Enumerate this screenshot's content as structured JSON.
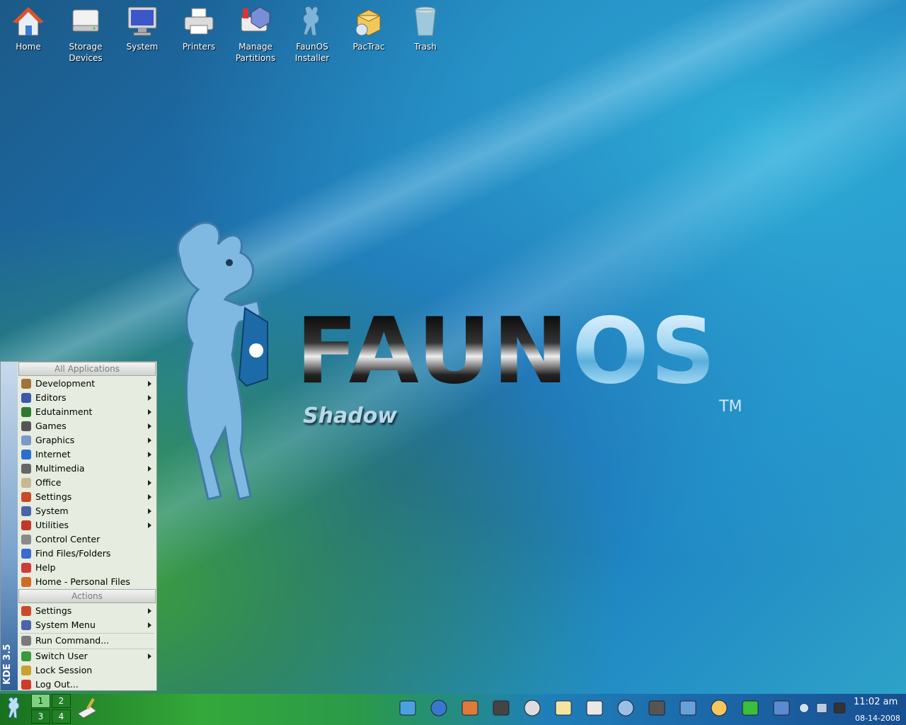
{
  "desktop_icons": [
    {
      "label": "Home",
      "icon": "home-icon"
    },
    {
      "label": "Storage\nDevices",
      "icon": "drive-icon"
    },
    {
      "label": "System",
      "icon": "monitor-icon"
    },
    {
      "label": "Printers",
      "icon": "printer-icon"
    },
    {
      "label": "Manage\nPartitions",
      "icon": "partition-icon"
    },
    {
      "label": "FaunOS\nInstaller",
      "icon": "goat-icon"
    },
    {
      "label": "PacTrac",
      "icon": "package-icon"
    },
    {
      "label": "Trash",
      "icon": "trash-icon"
    }
  ],
  "logo": {
    "faun": "FAUN",
    "os": "OS",
    "tm": "TM",
    "edition": "Shadow"
  },
  "kmenu": {
    "sidebar_text": "KDE 3.5",
    "header_all": "All Applications",
    "header_actions": "Actions",
    "apps": [
      {
        "label": "Development",
        "submenu": true,
        "color": "#a0743a"
      },
      {
        "label": "Editors",
        "submenu": true,
        "color": "#3a5aa8"
      },
      {
        "label": "Edutainment",
        "submenu": true,
        "color": "#2f7a2f"
      },
      {
        "label": "Games",
        "submenu": true,
        "color": "#555555"
      },
      {
        "label": "Graphics",
        "submenu": true,
        "color": "#7a98c8"
      },
      {
        "label": "Internet",
        "submenu": true,
        "color": "#2a6fd0"
      },
      {
        "label": "Multimedia",
        "submenu": true,
        "color": "#666666"
      },
      {
        "label": "Office",
        "submenu": true,
        "color": "#c8b890"
      },
      {
        "label": "Settings",
        "submenu": true,
        "color": "#c84a2a"
      },
      {
        "label": "System",
        "submenu": true,
        "color": "#4a64a8"
      },
      {
        "label": "Utilities",
        "submenu": true,
        "color": "#c0392b"
      },
      {
        "label": "Control Center",
        "submenu": false,
        "color": "#8a8a8a"
      },
      {
        "label": "Find Files/Folders",
        "submenu": false,
        "color": "#3a6ad0"
      },
      {
        "label": "Help",
        "submenu": false,
        "color": "#d03a3a"
      },
      {
        "label": "Home - Personal Files",
        "submenu": false,
        "color": "#d06a2a"
      }
    ],
    "actions": [
      {
        "label": "Settings",
        "submenu": true,
        "color": "#c84a2a"
      },
      {
        "label": "System Menu",
        "submenu": true,
        "color": "#4a64a8"
      },
      {
        "label": "Run Command...",
        "submenu": false,
        "color": "#7a7a7a"
      },
      {
        "label": "Switch User",
        "submenu": true,
        "color": "#3a9a3a"
      },
      {
        "label": "Lock Session",
        "submenu": false,
        "color": "#caa030"
      },
      {
        "label": "Log Out...",
        "submenu": false,
        "color": "#d03a2a"
      }
    ]
  },
  "pager": [
    "1",
    "2",
    "3",
    "4"
  ],
  "tray_icons": [
    "internet-explorer-icon",
    "globe-icon",
    "home-icon",
    "terminal-icon",
    "calendar-icon",
    "notepad-icon",
    "documents-icon",
    "drawing-icon",
    "film-reel-icon",
    "mail-icon",
    "package-icon",
    "wifi-icon",
    "browser-icon",
    "volume-icon",
    "network-icon",
    "printer-icon"
  ],
  "clock": {
    "time": "11:02 am",
    "date": "08-14-2008"
  }
}
